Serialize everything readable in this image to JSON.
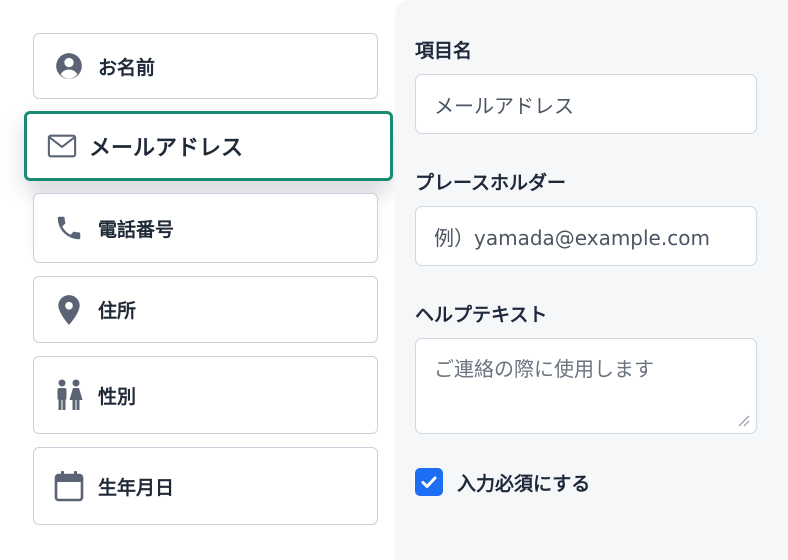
{
  "field_types": [
    {
      "label": "お名前",
      "icon": "person-circle-icon"
    },
    {
      "label": "メールアドレス",
      "icon": "envelope-icon",
      "selected": true
    },
    {
      "label": "電話番号",
      "icon": "phone-icon"
    },
    {
      "label": "住所",
      "icon": "location-pin-icon"
    },
    {
      "label": "性別",
      "icon": "gender-icon"
    },
    {
      "label": "生年月日",
      "icon": "calendar-icon"
    }
  ],
  "settings": {
    "item_name": {
      "label": "項目名",
      "value": "メールアドレス"
    },
    "placeholder": {
      "label": "プレースホルダー",
      "value": "例）yamada@example.com"
    },
    "help_text": {
      "label": "ヘルプテキスト",
      "placeholder": "ご連絡の際に使用します"
    },
    "required": {
      "label": "入力必須にする",
      "checked": true
    }
  },
  "colors": {
    "selected_border": "#1a8a72",
    "checkbox": "#1d6ef2",
    "icon": "#5b6474"
  }
}
